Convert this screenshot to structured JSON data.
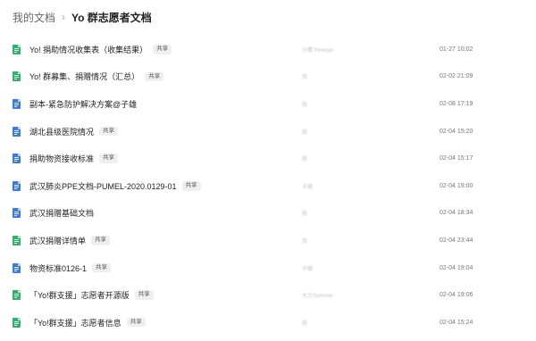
{
  "breadcrumb": {
    "root": "我的文档",
    "separator": "›",
    "current": "Yo 群志愿者文档"
  },
  "colors": {
    "sheet": "#2fb26a",
    "doc": "#3a7ae8"
  },
  "files": [
    {
      "icon": "sheet-icon",
      "name": "Yo! 捐助情况收集表（收集结果）",
      "shared": "共享",
      "owner": "沙鹰 Pinkeye",
      "time": "01-27 10:02"
    },
    {
      "icon": "sheet-icon",
      "name": "Yo! 群募集、捐赠情况（汇总）",
      "shared": "共享",
      "owner": "我",
      "time": "02-02 21:09"
    },
    {
      "icon": "doc-icon",
      "name": "副本-紧急防护解决方案@子雄",
      "shared": "",
      "owner": "我",
      "time": "02-08 17:19"
    },
    {
      "icon": "doc-icon",
      "name": "湖北县级医院情况",
      "shared": "共享",
      "owner": "我",
      "time": "02-04 15:20"
    },
    {
      "icon": "doc-icon",
      "name": "捐助物资接收标准",
      "shared": "共享",
      "owner": "我",
      "time": "02-04 15:17"
    },
    {
      "icon": "doc-icon",
      "name": "武汉肺炎PPE文档-PUMEL-2020.0129-01",
      "shared": "共享",
      "owner": "子雄",
      "time": "02-04 19:00"
    },
    {
      "icon": "doc-icon",
      "name": "武汉捐赠基础文档",
      "shared": "",
      "owner": "我",
      "time": "02-04 18:34"
    },
    {
      "icon": "sheet-icon",
      "name": "武汉捐赠详情单",
      "shared": "共享",
      "owner": "我",
      "time": "02-04 23:44"
    },
    {
      "icon": "doc-icon",
      "name": "物资标准0126-1",
      "shared": "共享",
      "owner": "子雄",
      "time": "02-04 19:04"
    },
    {
      "icon": "sheet-icon",
      "name": "「Yo!群支援」志愿者开源版",
      "shared": "共享",
      "owner": "大力Summer",
      "time": "02-04 19:06"
    },
    {
      "icon": "sheet-icon",
      "name": "「Yo!群支援」志愿者信息",
      "shared": "共享",
      "owner": "我",
      "time": "02-04 15:24"
    }
  ]
}
